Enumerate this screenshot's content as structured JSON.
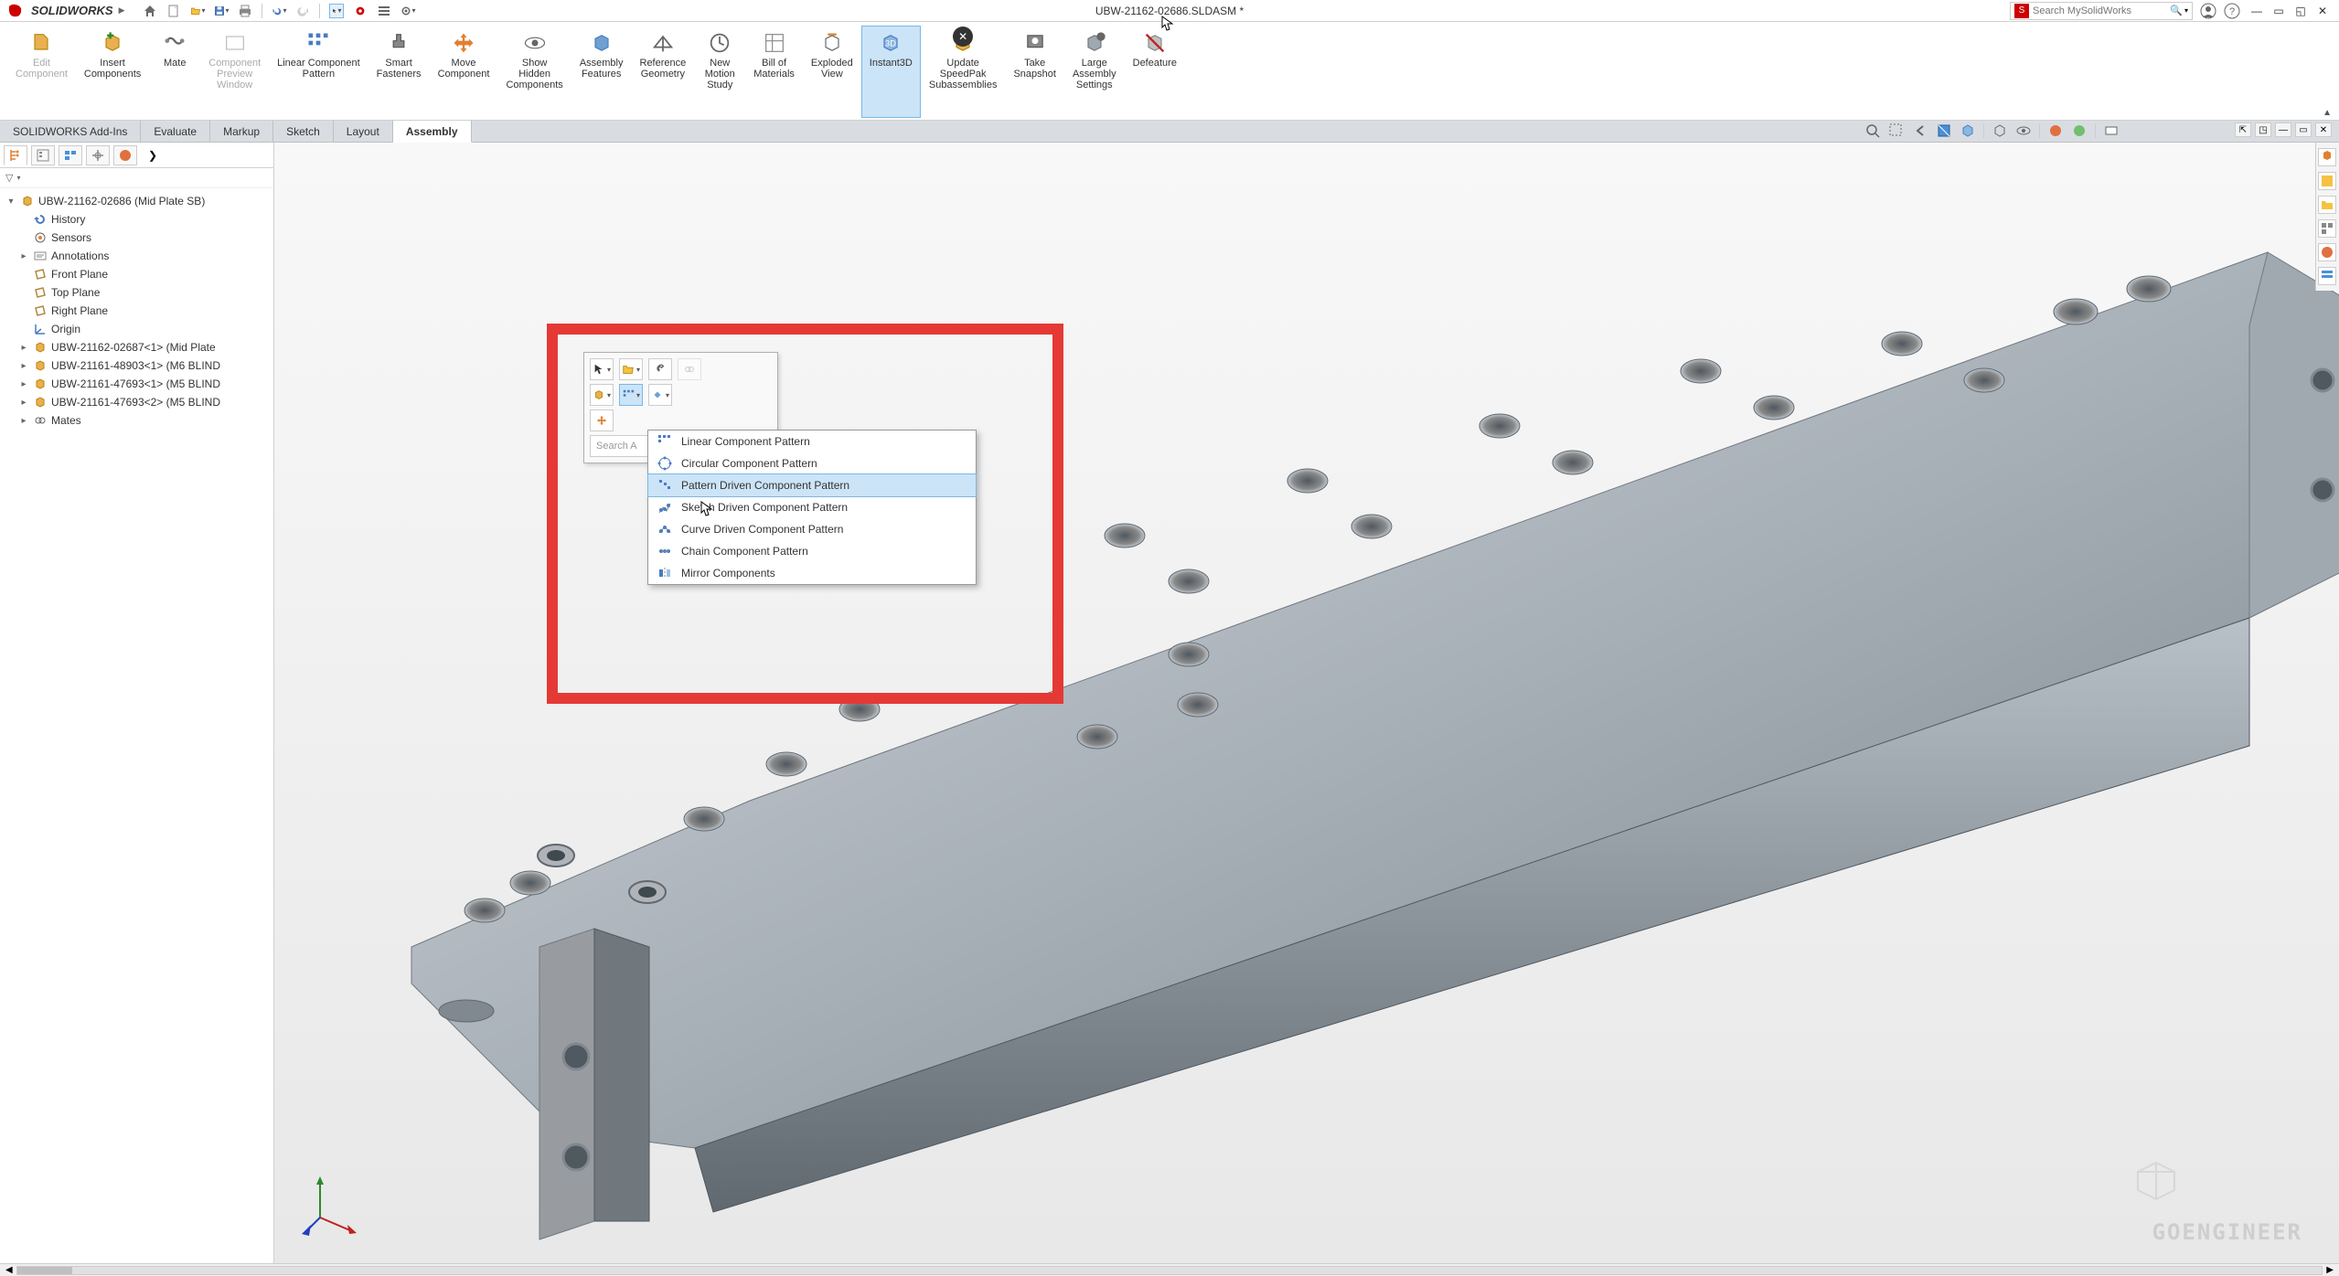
{
  "app": {
    "name_prefix": "S",
    "name": "SOLIDWORKS",
    "doc_title": "UBW-21162-02686.SLDASM *",
    "search_placeholder": "Search MySolidWorks"
  },
  "ribbon": [
    {
      "label": "Edit\nComponent",
      "disabled": true
    },
    {
      "label": "Insert\nComponents"
    },
    {
      "label": "Mate"
    },
    {
      "label": "Component\nPreview\nWindow",
      "disabled": true
    },
    {
      "label": "Linear Component\nPattern"
    },
    {
      "label": "Smart\nFasteners"
    },
    {
      "label": "Move\nComponent"
    },
    {
      "label": "Show\nHidden\nComponents"
    },
    {
      "label": "Assembly\nFeatures"
    },
    {
      "label": "Reference\nGeometry"
    },
    {
      "label": "New\nMotion\nStudy"
    },
    {
      "label": "Bill of\nMaterials"
    },
    {
      "label": "Exploded\nView"
    },
    {
      "label": "Instant3D",
      "active": true
    },
    {
      "label": "Update\nSpeedPak\nSubassemblies",
      "cancel": true
    },
    {
      "label": "Take\nSnapshot"
    },
    {
      "label": "Large\nAssembly\nSettings"
    },
    {
      "label": "Defeature"
    }
  ],
  "tabs": [
    "Assembly",
    "Layout",
    "Sketch",
    "Markup",
    "Evaluate",
    "SOLIDWORKS Add-Ins"
  ],
  "tree": {
    "root": "UBW-21162-02686 (Mid Plate SB)",
    "items": [
      {
        "label": "History",
        "icon": "history"
      },
      {
        "label": "Sensors",
        "icon": "sensor"
      },
      {
        "label": "Annotations",
        "icon": "annotation",
        "expandable": true
      },
      {
        "label": "Front Plane",
        "icon": "plane"
      },
      {
        "label": "Top Plane",
        "icon": "plane"
      },
      {
        "label": "Right Plane",
        "icon": "plane"
      },
      {
        "label": "Origin",
        "icon": "origin"
      },
      {
        "label": "UBW-21162-02687<1> (Mid Plate",
        "icon": "part",
        "expandable": true
      },
      {
        "label": "UBW-21161-48903<1> (M6 BLIND",
        "icon": "part",
        "expandable": true
      },
      {
        "label": "UBW-21161-47693<1> (M5 BLIND",
        "icon": "part",
        "expandable": true
      },
      {
        "label": "UBW-21161-47693<2> (M5 BLIND",
        "icon": "part",
        "expandable": true
      },
      {
        "label": "Mates",
        "icon": "mates",
        "expandable": true
      }
    ]
  },
  "context_search": "Search A",
  "pattern_menu": [
    {
      "label": "Linear Component Pattern"
    },
    {
      "label": "Circular Component Pattern"
    },
    {
      "label": "Pattern Driven Component Pattern",
      "highlight": true
    },
    {
      "label": "Sketch Driven Component Pattern"
    },
    {
      "label": "Curve Driven Component Pattern"
    },
    {
      "label": "Chain Component Pattern"
    },
    {
      "label": "Mirror Components"
    }
  ],
  "watermark": "GOENGINEER",
  "colors": {
    "accent": "#cce4f7",
    "accent_border": "#7ab8e6",
    "red_highlight": "#e53935",
    "brand_red": "#c00"
  }
}
